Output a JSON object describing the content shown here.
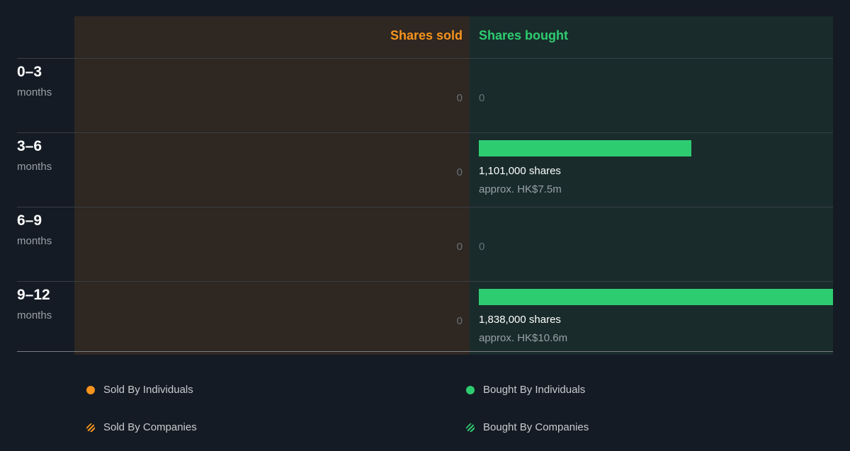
{
  "chart_data": {
    "type": "bar",
    "header": {
      "sold": "Shares sold",
      "bought": "Shares bought"
    },
    "rows": [
      {
        "range": "0–3",
        "unit": "months",
        "sold": "0",
        "bought": 0,
        "bought_label": "0",
        "shares_text": "",
        "approx_text": ""
      },
      {
        "range": "3–6",
        "unit": "months",
        "sold": "0",
        "bought": 1101000,
        "bought_label": "",
        "shares_text": "1,101,000 shares",
        "approx_text": "approx. HK$7.5m"
      },
      {
        "range": "6–9",
        "unit": "months",
        "sold": "0",
        "bought": 0,
        "bought_label": "0",
        "shares_text": "",
        "approx_text": ""
      },
      {
        "range": "9–12",
        "unit": "months",
        "sold": "0",
        "bought": 1838000,
        "bought_label": "",
        "shares_text": "1,838,000 shares",
        "approx_text": "approx. HK$10.6m"
      }
    ],
    "max_value": 1838000,
    "colors": {
      "sold": "#f7941d",
      "bought": "#2ecc71"
    }
  },
  "legend": {
    "sold_individuals": "Sold By Individuals",
    "bought_individuals": "Bought By Individuals",
    "sold_companies": "Sold By Companies",
    "bought_companies": "Bought By Companies"
  }
}
